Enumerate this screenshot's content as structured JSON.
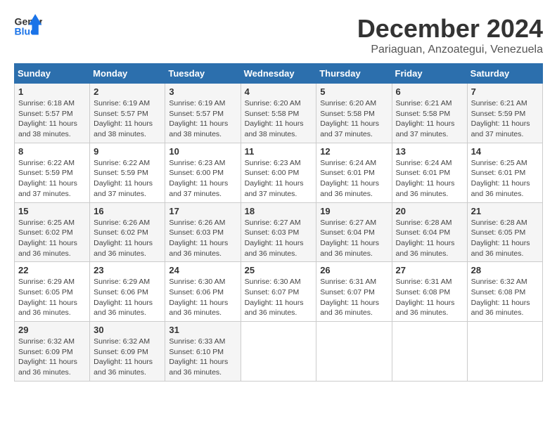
{
  "header": {
    "logo_general": "General",
    "logo_blue": "Blue",
    "month_year": "December 2024",
    "location": "Pariaguan, Anzoategui, Venezuela"
  },
  "calendar": {
    "days_of_week": [
      "Sunday",
      "Monday",
      "Tuesday",
      "Wednesday",
      "Thursday",
      "Friday",
      "Saturday"
    ],
    "weeks": [
      [
        {
          "day": "1",
          "info": "Sunrise: 6:18 AM\nSunset: 5:57 PM\nDaylight: 11 hours\nand 38 minutes."
        },
        {
          "day": "2",
          "info": "Sunrise: 6:19 AM\nSunset: 5:57 PM\nDaylight: 11 hours\nand 38 minutes."
        },
        {
          "day": "3",
          "info": "Sunrise: 6:19 AM\nSunset: 5:57 PM\nDaylight: 11 hours\nand 38 minutes."
        },
        {
          "day": "4",
          "info": "Sunrise: 6:20 AM\nSunset: 5:58 PM\nDaylight: 11 hours\nand 38 minutes."
        },
        {
          "day": "5",
          "info": "Sunrise: 6:20 AM\nSunset: 5:58 PM\nDaylight: 11 hours\nand 37 minutes."
        },
        {
          "day": "6",
          "info": "Sunrise: 6:21 AM\nSunset: 5:58 PM\nDaylight: 11 hours\nand 37 minutes."
        },
        {
          "day": "7",
          "info": "Sunrise: 6:21 AM\nSunset: 5:59 PM\nDaylight: 11 hours\nand 37 minutes."
        }
      ],
      [
        {
          "day": "8",
          "info": "Sunrise: 6:22 AM\nSunset: 5:59 PM\nDaylight: 11 hours\nand 37 minutes."
        },
        {
          "day": "9",
          "info": "Sunrise: 6:22 AM\nSunset: 5:59 PM\nDaylight: 11 hours\nand 37 minutes."
        },
        {
          "day": "10",
          "info": "Sunrise: 6:23 AM\nSunset: 6:00 PM\nDaylight: 11 hours\nand 37 minutes."
        },
        {
          "day": "11",
          "info": "Sunrise: 6:23 AM\nSunset: 6:00 PM\nDaylight: 11 hours\nand 37 minutes."
        },
        {
          "day": "12",
          "info": "Sunrise: 6:24 AM\nSunset: 6:01 PM\nDaylight: 11 hours\nand 36 minutes."
        },
        {
          "day": "13",
          "info": "Sunrise: 6:24 AM\nSunset: 6:01 PM\nDaylight: 11 hours\nand 36 minutes."
        },
        {
          "day": "14",
          "info": "Sunrise: 6:25 AM\nSunset: 6:01 PM\nDaylight: 11 hours\nand 36 minutes."
        }
      ],
      [
        {
          "day": "15",
          "info": "Sunrise: 6:25 AM\nSunset: 6:02 PM\nDaylight: 11 hours\nand 36 minutes."
        },
        {
          "day": "16",
          "info": "Sunrise: 6:26 AM\nSunset: 6:02 PM\nDaylight: 11 hours\nand 36 minutes."
        },
        {
          "day": "17",
          "info": "Sunrise: 6:26 AM\nSunset: 6:03 PM\nDaylight: 11 hours\nand 36 minutes."
        },
        {
          "day": "18",
          "info": "Sunrise: 6:27 AM\nSunset: 6:03 PM\nDaylight: 11 hours\nand 36 minutes."
        },
        {
          "day": "19",
          "info": "Sunrise: 6:27 AM\nSunset: 6:04 PM\nDaylight: 11 hours\nand 36 minutes."
        },
        {
          "day": "20",
          "info": "Sunrise: 6:28 AM\nSunset: 6:04 PM\nDaylight: 11 hours\nand 36 minutes."
        },
        {
          "day": "21",
          "info": "Sunrise: 6:28 AM\nSunset: 6:05 PM\nDaylight: 11 hours\nand 36 minutes."
        }
      ],
      [
        {
          "day": "22",
          "info": "Sunrise: 6:29 AM\nSunset: 6:05 PM\nDaylight: 11 hours\nand 36 minutes."
        },
        {
          "day": "23",
          "info": "Sunrise: 6:29 AM\nSunset: 6:06 PM\nDaylight: 11 hours\nand 36 minutes."
        },
        {
          "day": "24",
          "info": "Sunrise: 6:30 AM\nSunset: 6:06 PM\nDaylight: 11 hours\nand 36 minutes."
        },
        {
          "day": "25",
          "info": "Sunrise: 6:30 AM\nSunset: 6:07 PM\nDaylight: 11 hours\nand 36 minutes."
        },
        {
          "day": "26",
          "info": "Sunrise: 6:31 AM\nSunset: 6:07 PM\nDaylight: 11 hours\nand 36 minutes."
        },
        {
          "day": "27",
          "info": "Sunrise: 6:31 AM\nSunset: 6:08 PM\nDaylight: 11 hours\nand 36 minutes."
        },
        {
          "day": "28",
          "info": "Sunrise: 6:32 AM\nSunset: 6:08 PM\nDaylight: 11 hours\nand 36 minutes."
        }
      ],
      [
        {
          "day": "29",
          "info": "Sunrise: 6:32 AM\nSunset: 6:09 PM\nDaylight: 11 hours\nand 36 minutes."
        },
        {
          "day": "30",
          "info": "Sunrise: 6:32 AM\nSunset: 6:09 PM\nDaylight: 11 hours\nand 36 minutes."
        },
        {
          "day": "31",
          "info": "Sunrise: 6:33 AM\nSunset: 6:10 PM\nDaylight: 11 hours\nand 36 minutes."
        },
        {
          "day": "",
          "info": ""
        },
        {
          "day": "",
          "info": ""
        },
        {
          "day": "",
          "info": ""
        },
        {
          "day": "",
          "info": ""
        }
      ]
    ]
  }
}
